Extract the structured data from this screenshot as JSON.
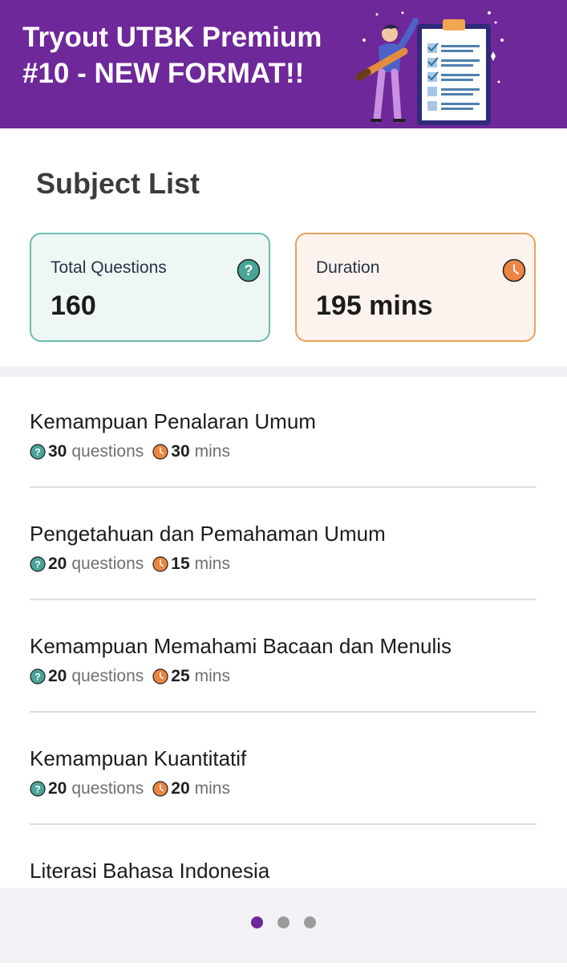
{
  "banner": {
    "title": "Tryout UTBK Premium\n#10 - NEW FORMAT!!"
  },
  "section_title": "Subject List",
  "stats": {
    "questions": {
      "label": "Total Questions",
      "value": "160",
      "icon": "question-icon",
      "color": "#4aa398"
    },
    "duration": {
      "label": "Duration",
      "value": "195 mins",
      "icon": "clock-icon",
      "color": "#ec8443"
    }
  },
  "subjects": [
    {
      "name": "Kemampuan Penalaran Umum",
      "questions": "30",
      "questions_unit": "questions",
      "minutes": "30",
      "minutes_unit": "mins"
    },
    {
      "name": "Pengetahuan dan Pemahaman Umum",
      "questions": "20",
      "questions_unit": "questions",
      "minutes": "15",
      "minutes_unit": "mins"
    },
    {
      "name": "Kemampuan Memahami Bacaan dan Menulis",
      "questions": "20",
      "questions_unit": "questions",
      "minutes": "25",
      "minutes_unit": "mins"
    },
    {
      "name": "Kemampuan Kuantitatif",
      "questions": "20",
      "questions_unit": "questions",
      "minutes": "20",
      "minutes_unit": "mins"
    },
    {
      "name": "Literasi Bahasa Indonesia"
    }
  ],
  "pagination": {
    "active_page": 1,
    "page_count": 3
  },
  "colors": {
    "brand": "#6e2899",
    "questions": "#4aa398",
    "duration": "#ec8443"
  }
}
